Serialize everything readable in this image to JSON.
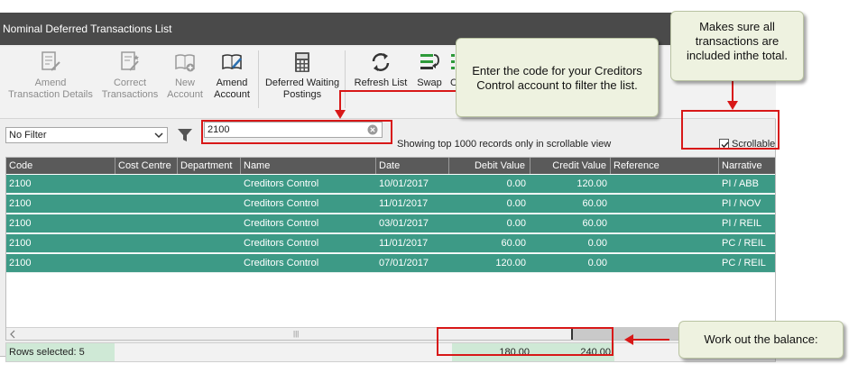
{
  "window": {
    "title": "Nominal Deferred Transactions List"
  },
  "toolbar": {
    "amend_details": {
      "line1": "Amend",
      "line2": "Transaction Details"
    },
    "correct": {
      "line1": "Correct",
      "line2": "Transactions"
    },
    "new_account": {
      "line1": "New",
      "line2": "Account"
    },
    "amend_account": {
      "line1": "Amend",
      "line2": "Account"
    },
    "deferred": {
      "line1": "Deferred Waiting",
      "line2": "Postings"
    },
    "refresh": "Refresh List",
    "swap": "Swap",
    "clear_partial": "C"
  },
  "filter": {
    "select_value": "No Filter",
    "search_value": "2100",
    "info": "Showing top 1000 records only in scrollable view",
    "scrollable_label": "Scrollable",
    "scrollable_checked": true
  },
  "grid": {
    "columns": [
      "Code",
      "Cost Centre",
      "Department",
      "Name",
      "Date",
      "Debit Value",
      "Credit Value",
      "Reference",
      "Narrative"
    ],
    "rows": [
      {
        "code": "2100",
        "cost_centre": "",
        "department": "",
        "name": "Creditors Control",
        "date": "10/01/2017",
        "debit": "0.00",
        "credit": "120.00",
        "reference": "",
        "narrative": "PI / ABB"
      },
      {
        "code": "2100",
        "cost_centre": "",
        "department": "",
        "name": "Creditors Control",
        "date": "11/01/2017",
        "debit": "0.00",
        "credit": "60.00",
        "reference": "",
        "narrative": "PI / NOV"
      },
      {
        "code": "2100",
        "cost_centre": "",
        "department": "",
        "name": "Creditors Control",
        "date": "03/01/2017",
        "debit": "0.00",
        "credit": "60.00",
        "reference": "",
        "narrative": "PI / REIL"
      },
      {
        "code": "2100",
        "cost_centre": "",
        "department": "",
        "name": "Creditors Control",
        "date": "11/01/2017",
        "debit": "60.00",
        "credit": "0.00",
        "reference": "",
        "narrative": "PC / REIL"
      },
      {
        "code": "2100",
        "cost_centre": "",
        "department": "",
        "name": "Creditors Control",
        "date": "07/01/2017",
        "debit": "120.00",
        "credit": "0.00",
        "reference": "",
        "narrative": "PC / REIL"
      }
    ],
    "scroll_grip": "|||"
  },
  "status": {
    "rows_selected": "Rows selected: 5",
    "total_debit": "180.00",
    "total_credit": "240.00"
  },
  "callouts": {
    "creditors": "Enter the code for your Creditors Control account to filter the list.",
    "scrollable": "Makes sure all transactions are included inthe total.",
    "balance": "Work out the balance:"
  },
  "colors": {
    "row_green": "#3d9a86",
    "total_green": "#cfe9d6",
    "header": "#5a5a5a",
    "title": "#4a4a4a",
    "highlight_red": "#d81818"
  }
}
